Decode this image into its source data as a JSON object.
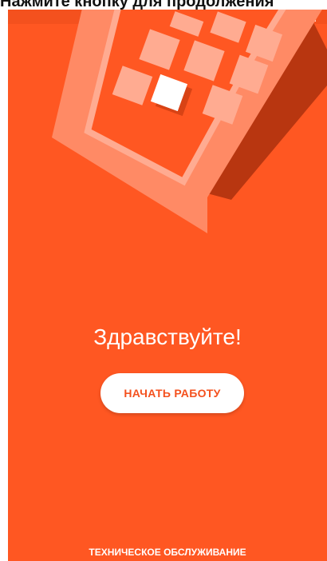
{
  "top_cut": {
    "text": "Нажмите кнопку для продолжения"
  },
  "main": {
    "greeting": "Здравствуйте!",
    "start_button_label": "НАЧАТЬ РАБОТУ",
    "maintenance_label": "ТЕХНИЧЕСКОЕ ОБСЛУЖИВАНИЕ"
  },
  "colors": {
    "background": "#ff5722",
    "status_bar": "#f4511e",
    "device_frame": "#ff8a65",
    "device_tile": "#ffab91",
    "device_shadow": "#b83610",
    "button_bg": "#ffffff",
    "button_text": "#f4511e"
  },
  "icons": {
    "status_signal": "signal-icon",
    "status_battery": "battery-icon",
    "hero": "payment-terminal-illustration"
  }
}
